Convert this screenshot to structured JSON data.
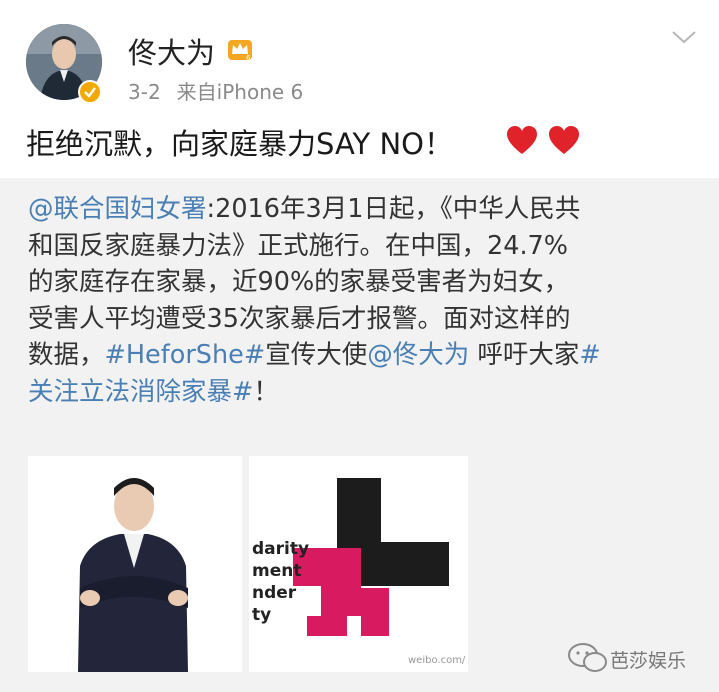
{
  "post": {
    "author": "佟大为",
    "date": "3-2",
    "source": "来自iPhone 6",
    "text": "拒绝沉默，向家庭暴力SAY NO！",
    "icons": {
      "avatar": "avatar",
      "verified": "verified-badge-icon",
      "crown": "crown-icon",
      "menu": "chevron-down-icon",
      "hearts": "heart-icon"
    }
  },
  "repost": {
    "mention": "@联合国妇女署",
    "line1": ":2016年3月1日起，《中华人民共",
    "line2": "和国反家庭暴力法》正式施行。在中国，24.7%",
    "line3": "的家庭存在家暴，近90%的家暴受害者为妇女，",
    "line4": "受害人平均遭受35次家暴后才报警。面对这样的",
    "line5a": "数据，",
    "hashtag1": "#HeforShe#",
    "line5b": "宣传大使",
    "mention2": "@佟大为",
    "line5c": " 呼吁大家",
    "hashtag2a": "#",
    "hashtag2b": "关注立法消除家暴#",
    "line6b": "！",
    "image2_lines": [
      "darity",
      "ment",
      "nder",
      "ty"
    ]
  },
  "watermark": "weibo.com/",
  "brand": {
    "name": "芭莎娱乐",
    "icon": "wechat-icon"
  },
  "colors": {
    "link": "#4a7fb5",
    "repost_bg": "#f2f2f2",
    "heart": "#e0222a",
    "crown": "#f5a623",
    "logo_pink": "#d81b60"
  }
}
